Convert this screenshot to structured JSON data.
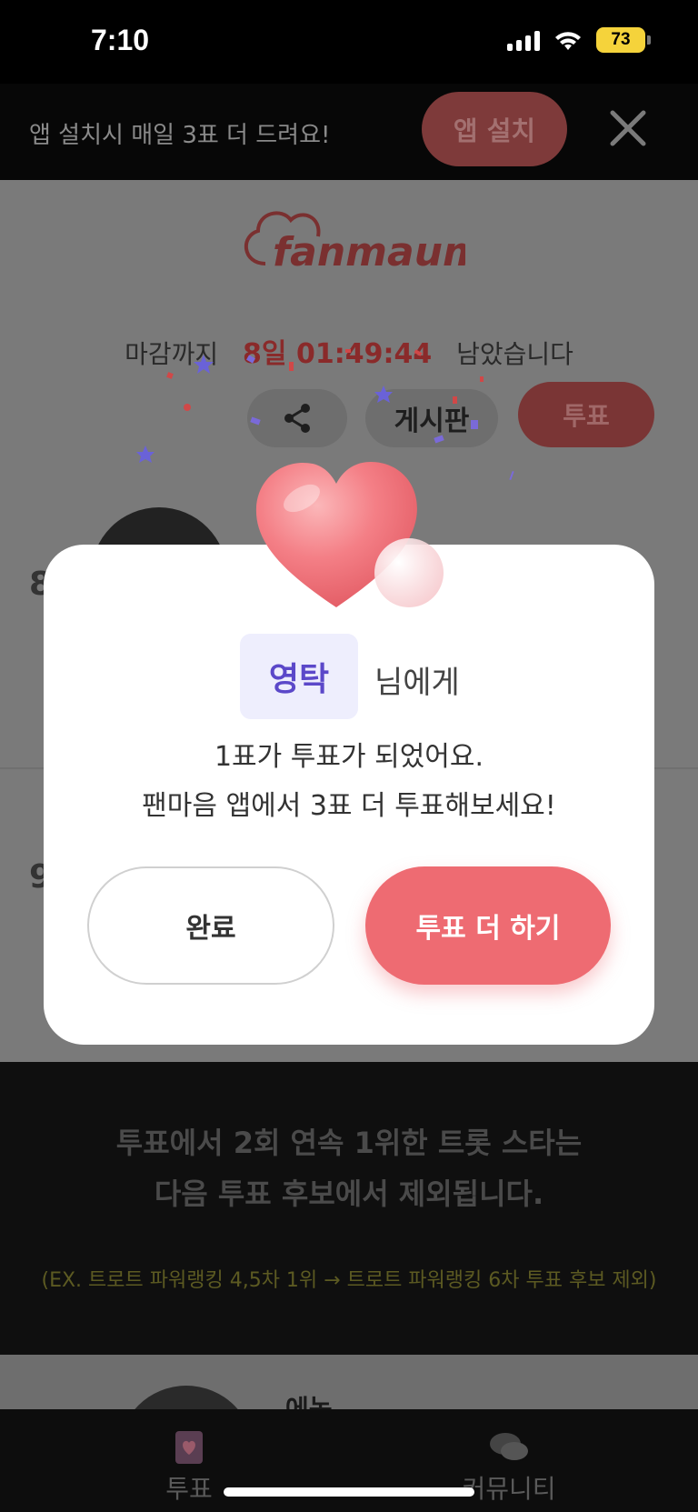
{
  "status_bar": {
    "time": "7:10",
    "battery": "73"
  },
  "install_banner": {
    "text": "앱 설치시 매일 3표 더 드려요!",
    "button_label": "앱 설치",
    "close_icon": "close-icon"
  },
  "header": {
    "logo_text": "fanmaum"
  },
  "countdown": {
    "prefix": "마감까지",
    "time": "8일 01:49:44",
    "suffix": "남았습니다"
  },
  "actions": {
    "share_icon": "share-icon",
    "board_label": "게시판",
    "vote_label": "투표"
  },
  "ranks": {
    "first": "8",
    "second": "9"
  },
  "modal": {
    "recipient": "영탁",
    "recipient_suffix": "님에게",
    "message_line1": "1표가 투표가 되었어요.",
    "message_line2": "팬마음 앱에서 3표 더 투표해보세요!",
    "done_label": "완료",
    "vote_more_label": "투표 더 하기",
    "heart_icon": "heart-icon"
  },
  "notice": {
    "line1": "투표에서 2회 연속 1위한 트롯 스타는",
    "line2": "다음 투표 후보에서 제외됩니다.",
    "example": "(EX.  트로트 파워랭킹 4,5차 1위 → 트로트 파워랭킹 6차 투표 후보 제외)"
  },
  "lower_card": {
    "name": "에녹"
  },
  "tab_bar": {
    "tabs": [
      {
        "label": "투표",
        "icon": "vote-card-icon"
      },
      {
        "label": "커뮤니티",
        "icon": "chat-bubbles-icon"
      }
    ]
  },
  "colors": {
    "accent": "#ee6b72",
    "recipient": "#5b48c9",
    "recipient_bg": "#eeeefd"
  }
}
